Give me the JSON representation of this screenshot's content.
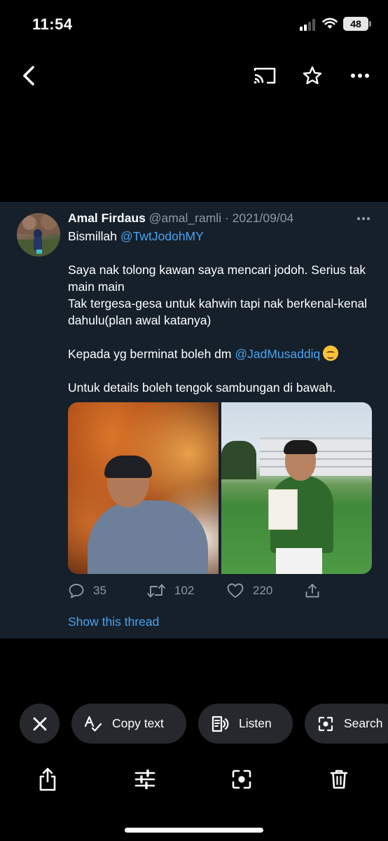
{
  "status_bar": {
    "time": "11:54",
    "battery": "48"
  },
  "nav": {
    "back_icon": "chevron-left-icon",
    "cast_icon": "cast-icon",
    "favorite_icon": "star-icon",
    "more_icon": "more-horizontal-icon"
  },
  "tweet": {
    "author_name": "Amal Firdaus",
    "meta": " @amal_ramli · 2021/09/04",
    "text": {
      "greeting": "Bismillah ",
      "mention1": "@TwtJodohMY",
      "line1": "Saya nak tolong kawan saya mencari jodoh. Serius tak main main",
      "line2": "Tak tergesa-gesa untuk kahwin tapi nak berkenal-kenal dahulu(plan awal katanya)",
      "line3_prefix": "Kepada yg berminat boleh dm ",
      "mention2": "@JadMusaddiq",
      "line4": "Untuk details boleh tengok sambungan di bawah."
    },
    "stats": {
      "replies": "35",
      "retweets": "102",
      "likes": "220"
    },
    "show_thread": "Show this thread"
  },
  "lens_chips": {
    "copy_text": "Copy text",
    "listen": "Listen",
    "search": "Search"
  },
  "colors": {
    "background": "#000000",
    "card": "#15202b",
    "link": "#4aa3f0",
    "muted": "#8b98a5",
    "chip": "#26282d"
  }
}
